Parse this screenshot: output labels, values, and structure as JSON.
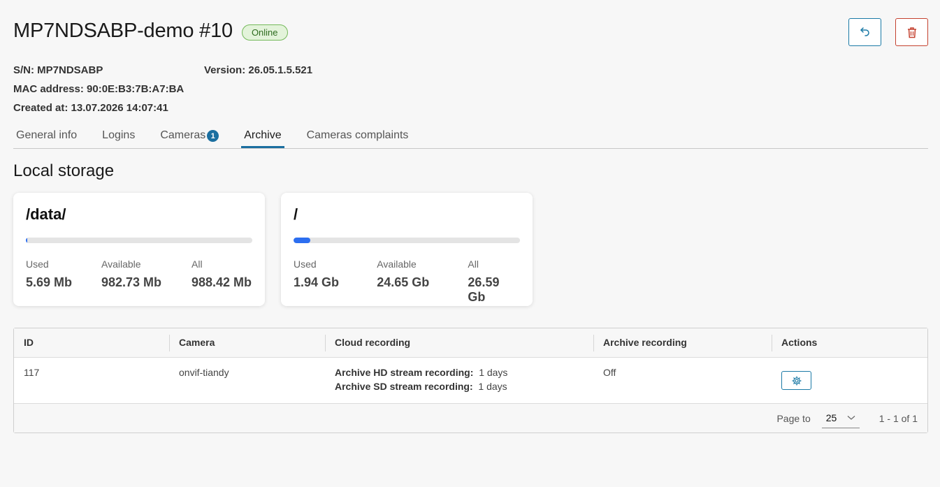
{
  "header": {
    "title": "MP7NDSABP-demo #10",
    "status": "Online",
    "undo_icon": "undo-icon",
    "delete_icon": "trash-icon"
  },
  "meta": {
    "sn_label": "S/N:",
    "sn_value": "MP7NDSABP",
    "version_label": "Version:",
    "version_value": "26.05.1.5.521",
    "mac_label": "MAC address:",
    "mac_value": "90:0E:B3:7B:A7:BA",
    "created_label": "Created at:",
    "created_value": "13.07.2026 14:07:41"
  },
  "tabs": [
    {
      "label": "General info"
    },
    {
      "label": "Logins"
    },
    {
      "label": "Cameras",
      "count": "1"
    },
    {
      "label": "Archive",
      "active": true
    },
    {
      "label": "Cameras complaints"
    }
  ],
  "section_title": "Local storage",
  "storage": [
    {
      "path": "/data/",
      "used_fraction": 0.006,
      "used_label": "Used",
      "used": "5.69 Mb",
      "available_label": "Available",
      "available": "982.73 Mb",
      "all_label": "All",
      "all": "988.42 Mb"
    },
    {
      "path": "/",
      "used_fraction": 0.073,
      "used_label": "Used",
      "used": "1.94 Gb",
      "available_label": "Available",
      "available": "24.65 Gb",
      "all_label": "All",
      "all": "26.59 Gb"
    }
  ],
  "table": {
    "columns": [
      "ID",
      "Camera",
      "Cloud recording",
      "Archive recording",
      "Actions"
    ],
    "rows": [
      {
        "id": "117",
        "camera": "onvif-tiandy",
        "hd_label": "Archive HD stream recording:",
        "hd_value": "1 days",
        "sd_label": "Archive SD stream recording:",
        "sd_value": "1 days",
        "archive_recording": "Off",
        "action_icon": "gear-icon"
      }
    ],
    "footer": {
      "page_to_label": "Page to",
      "page_size": "25",
      "range": "1 - 1 of 1"
    }
  },
  "colors": {
    "accent": "#1b6fa0",
    "danger": "#c4412f",
    "online_bg": "#e3f3da",
    "bar_fill": "#2c6ef0"
  }
}
